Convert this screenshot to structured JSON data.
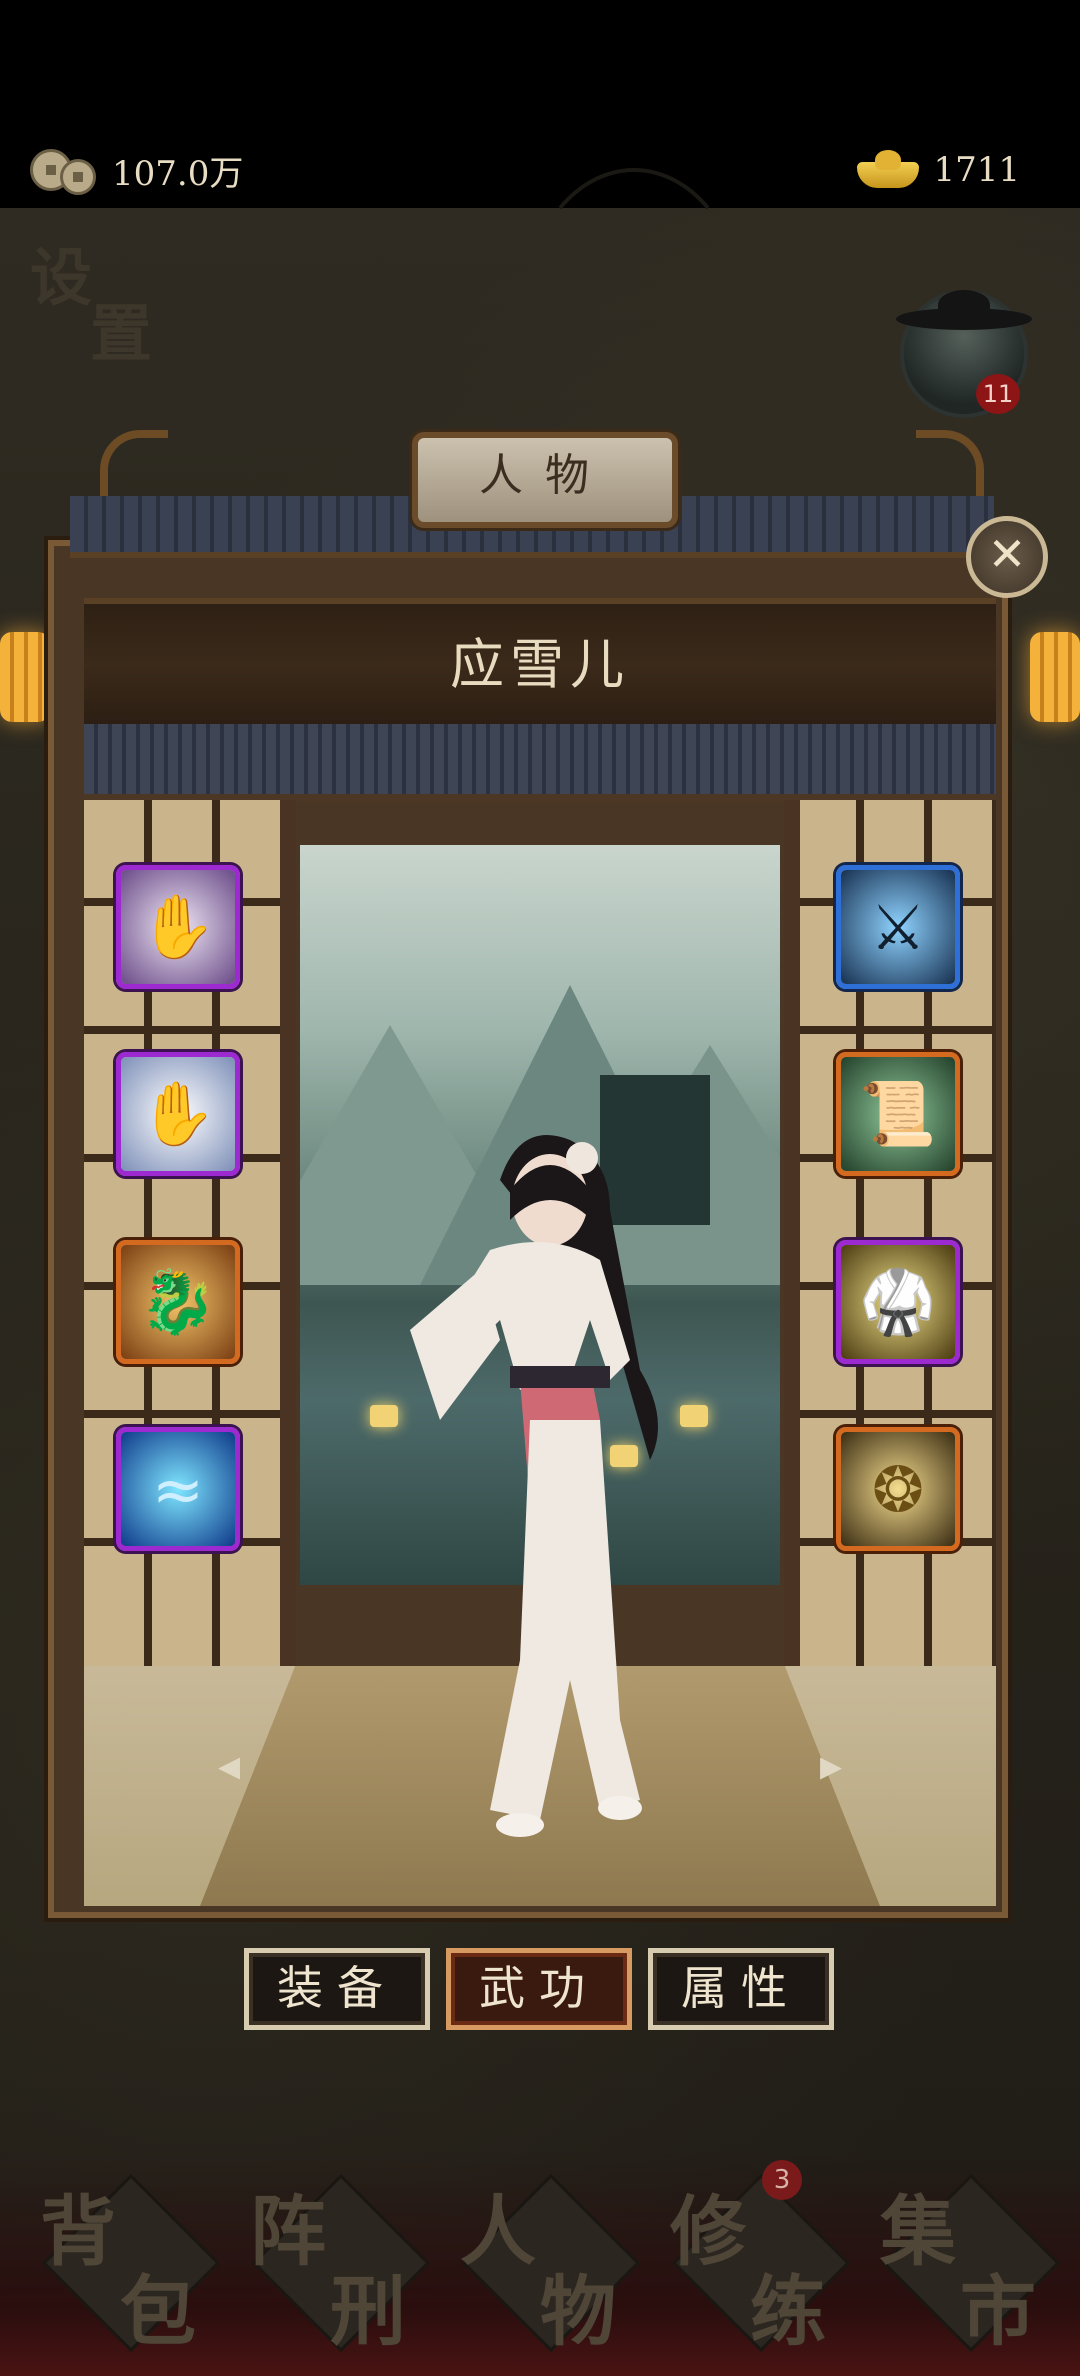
{
  "currency": {
    "coins": "107.0万",
    "gold": "1711"
  },
  "map": {
    "settings_label": "设置",
    "settings_l1": "设",
    "settings_l2": "置",
    "avatar_badge": "11"
  },
  "panel": {
    "title": "人物",
    "character_name": "应雪儿"
  },
  "skills": {
    "left": [
      {
        "icon": "palm-icon",
        "color": "purple"
      },
      {
        "icon": "strike-hand-icon",
        "color": "purple"
      },
      {
        "icon": "dragon-icon",
        "color": "orange"
      },
      {
        "icon": "water-spirit-icon",
        "color": "purple"
      }
    ],
    "right": [
      {
        "icon": "swordsman-icon",
        "color": "blue"
      },
      {
        "icon": "scroll-icon",
        "color": "orange"
      },
      {
        "icon": "martial-artist-icon",
        "color": "purple"
      },
      {
        "icon": "golden-emblem-icon",
        "color": "orange"
      }
    ]
  },
  "tabs": {
    "equip": "装备",
    "martial": "武功",
    "attributes": "属性",
    "active": "martial"
  },
  "bottom_nav": {
    "items": [
      {
        "label": "背包",
        "c1": "背",
        "c2": "包"
      },
      {
        "label": "阵刑",
        "c1": "阵",
        "c2": "刑"
      },
      {
        "label": "人物",
        "c1": "人",
        "c2": "物"
      },
      {
        "label": "修练",
        "c1": "修",
        "c2": "练",
        "badge": "3"
      },
      {
        "label": "集市",
        "c1": "集",
        "c2": "市"
      }
    ]
  },
  "colors": {
    "panel_wood": "#4a3624",
    "active_tab": "#d79a61",
    "purple_frame": "#9d2ad0",
    "blue_frame": "#2f6fd8",
    "orange_frame": "#d36a20"
  }
}
